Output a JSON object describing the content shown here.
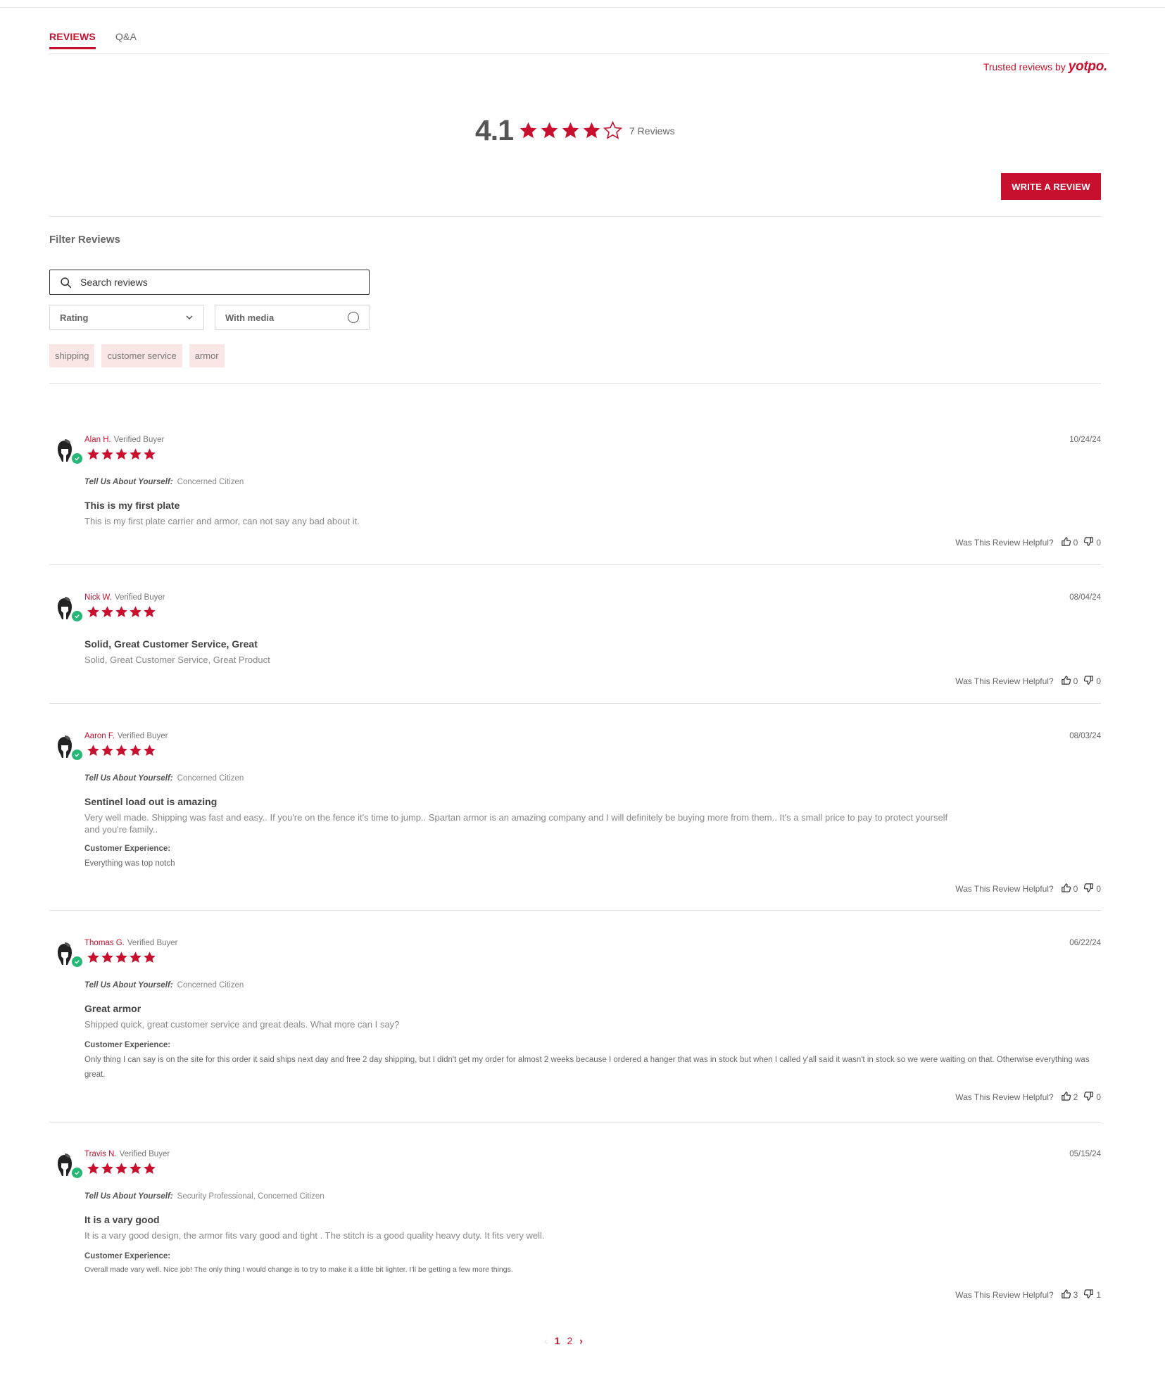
{
  "colors": {
    "accent": "#c8102e",
    "verified": "#26b777",
    "chip_bg": "#fbe6e6"
  },
  "tabs": [
    {
      "label": "REVIEWS",
      "active": true
    },
    {
      "label": "Q&A",
      "active": false
    }
  ],
  "trusted": {
    "text": "Trusted reviews by",
    "brand": "yotpo."
  },
  "summary": {
    "average": "4.1",
    "rating": 4.1,
    "count_label": "7 Reviews"
  },
  "write_review_label": "WRITE A REVIEW",
  "filters": {
    "title": "Filter Reviews",
    "search_placeholder": "Search reviews",
    "rating_label": "Rating",
    "media_label": "With media",
    "chips": [
      "shipping",
      "customer service",
      "armor"
    ]
  },
  "reviews": [
    {
      "name": "Alan H.",
      "badge": "Verified Buyer",
      "date": "10/24/24",
      "stars": 5,
      "question": "Tell Us About Yourself:",
      "answer": "Concerned Citizen",
      "title": "This is my first plate",
      "body": "This is my first plate carrier and armor, can not say any bad about it.",
      "helpful_label": "Was This Review Helpful?",
      "up": "0",
      "down": "0"
    },
    {
      "name": "Nick W.",
      "badge": "Verified Buyer",
      "date": "08/04/24",
      "stars": 5,
      "title": "Solid, Great Customer Service, Great",
      "body": "Solid, Great Customer Service, Great Product",
      "helpful_label": "Was This Review Helpful?",
      "up": "0",
      "down": "0"
    },
    {
      "name": "Aaron F.",
      "badge": "Verified Buyer",
      "date": "08/03/24",
      "stars": 5,
      "question": "Tell Us About Yourself:",
      "answer": "Concerned Citizen",
      "title": "Sentinel load out is amazing",
      "body": "Very well made. Shipping was fast and easy.. If you're on the fence it's time to jump.. Spartan armor is an amazing company and I will definitely be buying more from them.. It's a small price to pay to protect yourself and you're family..",
      "cx_label": "Customer Experience:",
      "cx_text": "Everything was top notch",
      "helpful_label": "Was This Review Helpful?",
      "up": "0",
      "down": "0"
    },
    {
      "name": "Thomas G.",
      "badge": "Verified Buyer",
      "date": "06/22/24",
      "stars": 5,
      "question": "Tell Us About Yourself:",
      "answer": "Concerned Citizen",
      "title": "Great armor",
      "body": "Shipped quick, great customer service and great deals. What more can I say?",
      "cx_label": "Customer Experience:",
      "cx_text": "Only thing I can say is on the site for this order it said ships next day and free 2 day shipping, but I didn't get my order for almost 2 weeks because I ordered a hanger that was in stock but when I called y'all said it wasn't in stock so we were waiting on that. Otherwise everything was great.",
      "helpful_label": "Was This Review Helpful?",
      "up": "2",
      "down": "0"
    },
    {
      "name": "Travis N.",
      "badge": "Verified Buyer",
      "date": "05/15/24",
      "stars": 5,
      "question": "Tell Us About Yourself:",
      "answer": "Security Professional, Concerned Citizen",
      "title": "It is a vary good",
      "body": "It is a vary good design, the armor fits vary good and tight . The stitch is a good quality heavy duty. It fits very well.",
      "cx_label": "Customer Experience:",
      "cx_text": "Overall made vary well. Nice job! The only thing I would change is to try to make it a little bit lighter. I'll be getting a few more things.",
      "helpful_label": "Was This Review Helpful?",
      "up": "3",
      "down": "1"
    }
  ],
  "pagination": {
    "pages": [
      "1",
      "2"
    ],
    "current": "1"
  }
}
